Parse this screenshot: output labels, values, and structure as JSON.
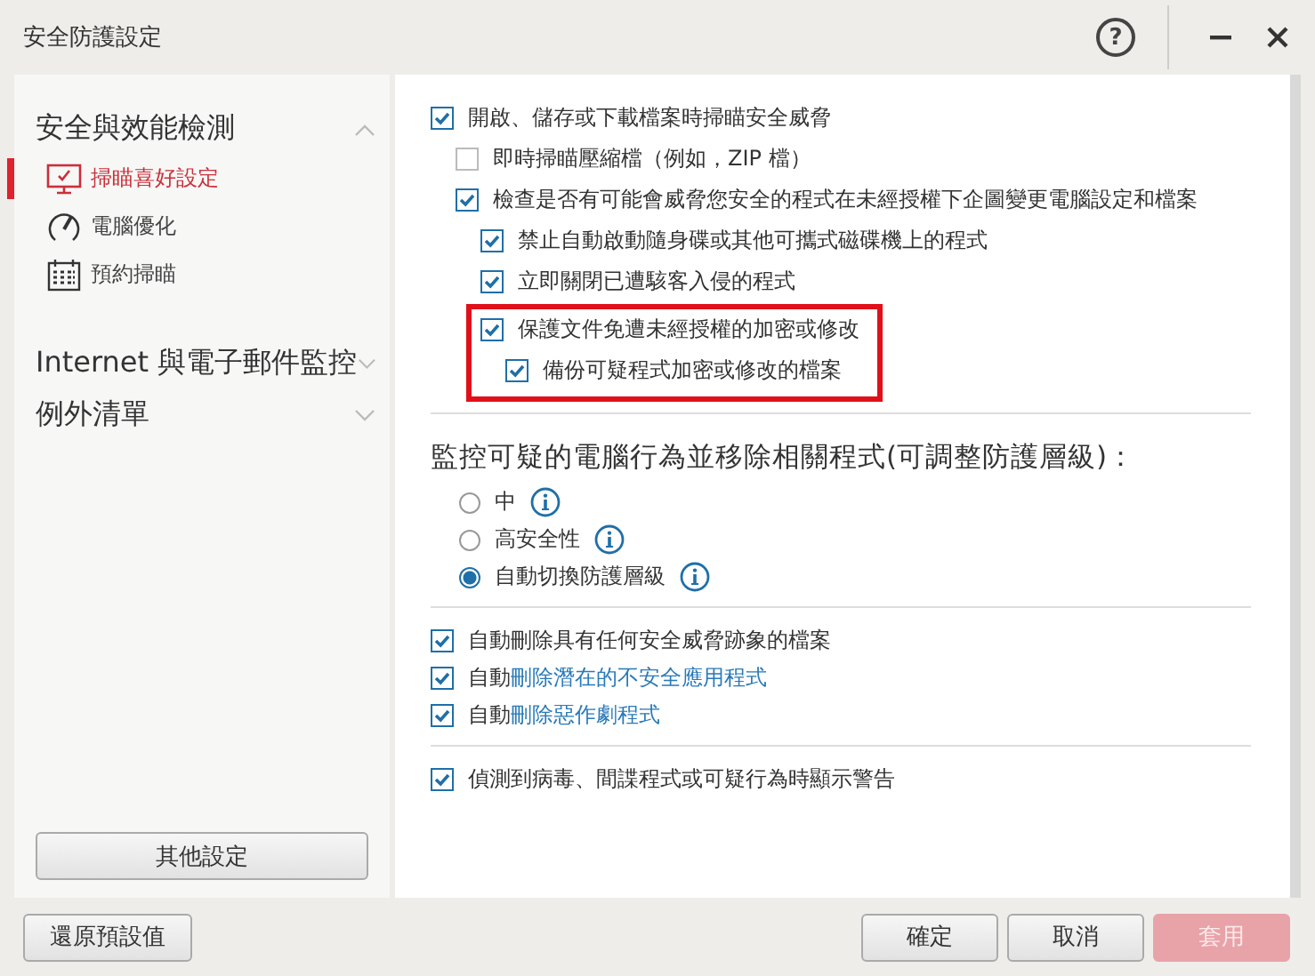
{
  "window": {
    "title": "安全防護設定",
    "help": "?"
  },
  "sidebar": {
    "groups": [
      {
        "label": "安全與效能檢測",
        "expanded": true,
        "items": [
          {
            "label": "掃瞄喜好設定",
            "selected": true
          },
          {
            "label": "電腦優化",
            "selected": false
          },
          {
            "label": "預約掃瞄",
            "selected": false
          }
        ]
      },
      {
        "label": "Internet 與電子郵件監控",
        "expanded": false
      },
      {
        "label": "例外清單",
        "expanded": false
      }
    ],
    "button": "其他設定"
  },
  "options": [
    {
      "text": "開啟、儲存或下載檔案時掃瞄安全威脅",
      "checked": true,
      "children": [
        {
          "text": "即時掃瞄壓縮檔（例如，ZIP 檔）",
          "checked": false
        },
        {
          "text": "檢查是否有可能會威脅您安全的程式在未經授權下企圖變更電腦設定和檔案",
          "checked": true,
          "children": [
            {
              "text": "禁止自動啟動隨身碟或其他可攜式磁碟機上的程式",
              "checked": true
            },
            {
              "text": "立即關閉已遭駭客入侵的程式",
              "checked": true
            },
            {
              "text": "保護文件免遭未經授權的加密或修改",
              "checked": true,
              "highlighted": true,
              "children": [
                {
                  "text": "備份可疑程式加密或修改的檔案",
                  "checked": true
                }
              ]
            }
          ]
        }
      ]
    }
  ],
  "monitor": {
    "heading": "監控可疑的電腦行為並移除相關程式(可調整防護層級)：",
    "levels": [
      {
        "label": "中",
        "selected": false
      },
      {
        "label": "高安全性",
        "selected": false
      },
      {
        "label": "自動切換防護層級",
        "selected": true
      }
    ]
  },
  "removal": [
    {
      "text": "自動刪除具有任何安全威脅跡象的檔案",
      "checked": true
    },
    {
      "text": "自動",
      "link": "刪除潛在的不安全應用程式",
      "checked": true
    },
    {
      "text": "自動",
      "link": "刪除惡作劇程式",
      "checked": true
    }
  ],
  "alerts": [
    {
      "text": "偵測到病毒、間諜程式或可疑行為時顯示警告",
      "checked": true
    }
  ],
  "footer": {
    "reset": "還原預設值",
    "ok": "確定",
    "cancel": "取消",
    "apply": "套用",
    "apply_disabled": true
  }
}
